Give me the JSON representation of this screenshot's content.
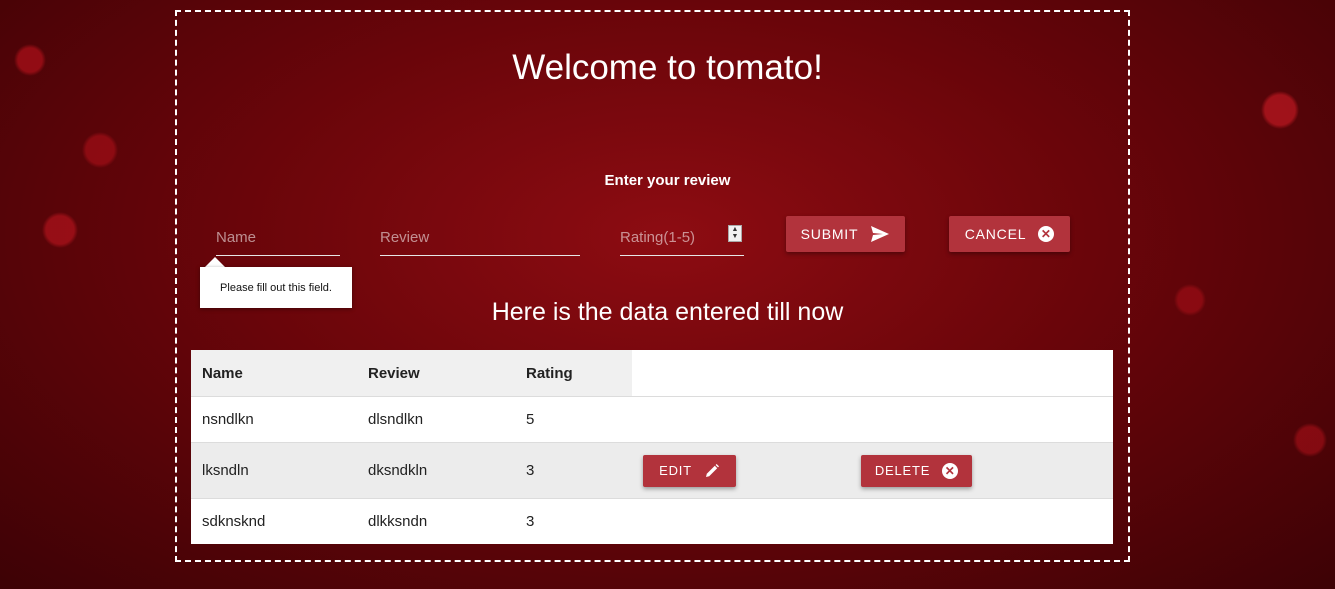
{
  "header": {
    "title": "Welcome to tomato!"
  },
  "form": {
    "label": "Enter your review",
    "name_placeholder": "Name",
    "review_placeholder": "Review",
    "rating_placeholder": "Rating(1-5)",
    "submit_label": "SUBMIT",
    "cancel_label": "CANCEL",
    "validation_message": "Please fill out this field."
  },
  "table": {
    "heading": "Here is the data entered till now",
    "columns": [
      "Name",
      "Review",
      "Rating"
    ],
    "rows": [
      {
        "name": "nsndlkn",
        "review": "dlsndlkn",
        "rating": "5"
      },
      {
        "name": "lksndln",
        "review": "dksndkln",
        "rating": "3"
      },
      {
        "name": "sdknsknd",
        "review": "dlkksndn",
        "rating": "3"
      }
    ],
    "edit_label": "EDIT",
    "delete_label": "DELETE"
  },
  "icons": {
    "submit": "send-icon",
    "cancel": "close-circle-icon",
    "edit": "pencil-icon",
    "delete": "close-circle-icon"
  },
  "colors": {
    "accent": "#b2333c",
    "background": "#6a050a"
  }
}
